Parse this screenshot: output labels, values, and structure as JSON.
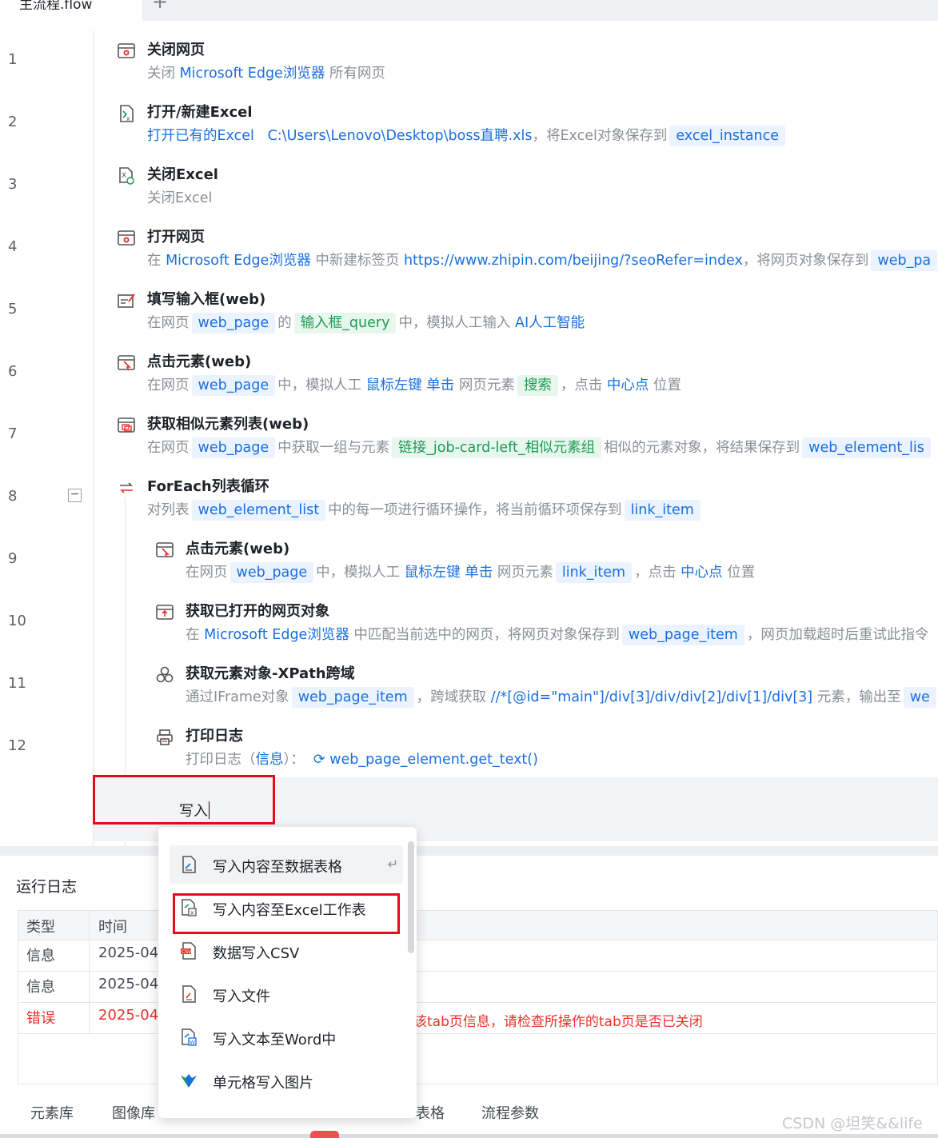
{
  "tab": {
    "title": "主流程.flow",
    "add": "+"
  },
  "line_numbers": [
    "1",
    "2",
    "3",
    "4",
    "5",
    "6",
    "7",
    "8",
    "9",
    "10",
    "11",
    "12"
  ],
  "steps": [
    {
      "icon": "close-webpage-icon",
      "title": "关闭网页",
      "desc": [
        "关闭 ",
        "Microsoft Edge浏览器",
        " 所有网页"
      ]
    },
    {
      "icon": "open-excel-icon",
      "title": "打开/新建Excel",
      "desc": [
        "打开已有的Excel",
        "C:\\Users\\Lenovo\\Desktop\\boss直聘.xls",
        "，将Excel对象保存到",
        "excel_instance"
      ]
    },
    {
      "icon": "close-excel-icon",
      "title": "关闭Excel",
      "desc": [
        "关闭Excel"
      ]
    },
    {
      "icon": "open-webpage-icon",
      "title": "打开网页",
      "desc": [
        "在 ",
        "Microsoft Edge浏览器",
        " 中新建标签页 ",
        "https://www.zhipin.com/beijing/?seoRefer=index",
        "，将网页对象保存到",
        "web_pa"
      ]
    },
    {
      "icon": "fill-input-icon",
      "title": "填写输入框(web)",
      "desc": [
        "在网页",
        "web_page",
        "的",
        "输入框_query",
        "中，模拟人工输入 ",
        "AI人工智能"
      ]
    },
    {
      "icon": "click-element-icon",
      "title": "点击元素(web)",
      "desc": [
        "在网页",
        "web_page",
        "中，模拟人工 ",
        "鼠标左键 单击",
        " 网页元素",
        "搜索",
        "，点击 ",
        "中心点",
        " 位置"
      ]
    },
    {
      "icon": "similar-elements-icon",
      "title": "获取相似元素列表(web)",
      "desc": [
        "在网页",
        "web_page",
        "中获取一组与元素",
        "链接_job-card-left_相似元素组",
        "相似的元素对象，将结果保存到",
        "web_element_lis"
      ]
    },
    {
      "icon": "foreach-loop-icon",
      "title": "ForEach列表循环",
      "desc": [
        "对列表",
        "web_element_list",
        "中的每一项进行循环操作，将当前循环项保存到",
        "link_item"
      ]
    },
    {
      "icon": "click-element-icon",
      "title": "点击元素(web)",
      "desc": [
        "在网页",
        "web_page",
        "中，模拟人工 ",
        "鼠标左键 单击",
        " 网页元素",
        "link_item",
        "，点击 ",
        "中心点",
        " 位置"
      ]
    },
    {
      "icon": "get-opened-webpage-icon",
      "title": "获取已打开的网页对象",
      "desc": [
        "在 ",
        "Microsoft Edge浏览器",
        " 中匹配当前选中的网页，将网页对象保存到",
        "web_page_item",
        "，网页加载超时后重试此指令"
      ]
    },
    {
      "icon": "xpath-cross-domain-icon",
      "title": "获取元素对象-XPath跨域",
      "desc": [
        "通过IFrame对象",
        "web_page_item",
        "，跨域获取 ",
        "//*[@id=\"main\"]/div[3]/div/div[2]/div[1]/div[3]",
        " 元素，输出至",
        "we"
      ]
    },
    {
      "icon": "print-log-icon",
      "title": "打印日志",
      "desc": [
        "打印日志（",
        "信息",
        "）：",
        "web_page_element.get_text()"
      ]
    }
  ],
  "input": {
    "value": "写入"
  },
  "dropdown": {
    "items": [
      {
        "icon": "datatable-write-icon",
        "label": "写入内容至数据表格",
        "hint": "↵"
      },
      {
        "icon": "excel-write-icon",
        "label": "写入内容至Excel工作表"
      },
      {
        "icon": "csv-write-icon",
        "label": "数据写入CSV"
      },
      {
        "icon": "file-write-icon",
        "label": "写入文件"
      },
      {
        "icon": "word-write-icon",
        "label": "写入文本至Word中"
      },
      {
        "icon": "cell-image-icon",
        "label": "单元格写入图片"
      }
    ]
  },
  "log": {
    "title": "运行日志",
    "columns": [
      "类型",
      "时间"
    ],
    "rows": [
      {
        "type": "信息",
        "time": "2025-04",
        "message": ""
      },
      {
        "type": "信息",
        "time": "2025-04",
        "message": ""
      },
      {
        "type": "错误",
        "time": "2025-04",
        "message": "该tab页信息，请检查所操作的tab页是否已关闭"
      }
    ]
  },
  "bottom_tabs": [
    "元素库",
    "图像库",
    "表格",
    "流程参数"
  ],
  "watermark": "CSDN @坦笑&&life"
}
